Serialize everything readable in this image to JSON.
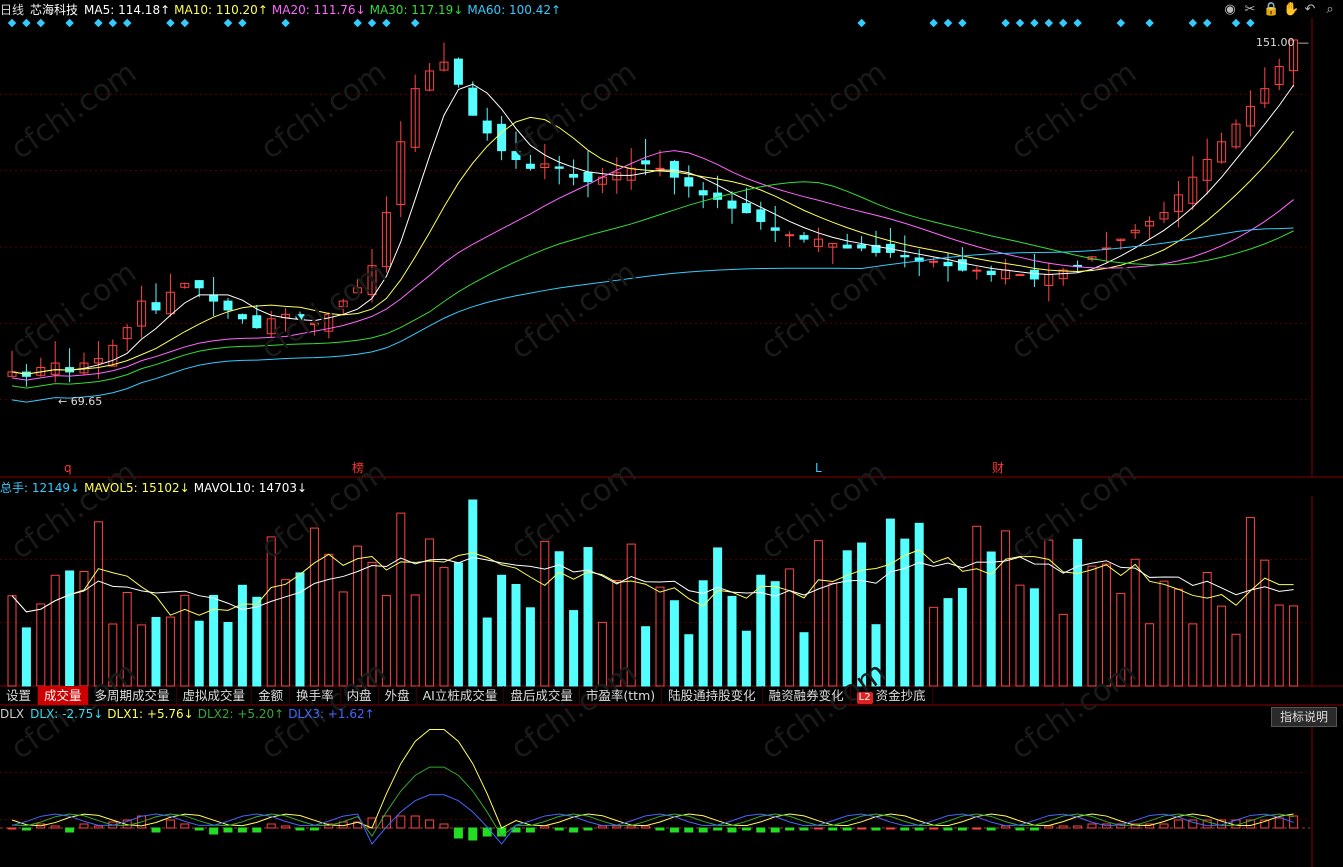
{
  "header": {
    "period": "日线",
    "stock_name": "芯海科技",
    "ma": [
      {
        "label": "MA5:",
        "value": "114.18",
        "arrow": "↑",
        "color": "#ffffff"
      },
      {
        "label": "MA10:",
        "value": "110.20",
        "arrow": "↑",
        "color": "#ffff55"
      },
      {
        "label": "MA20:",
        "value": "111.76",
        "arrow": "↓",
        "color": "#ff66ff"
      },
      {
        "label": "MA30:",
        "value": "117.19",
        "arrow": "↓",
        "color": "#33dd33"
      },
      {
        "label": "MA60:",
        "value": "100.42",
        "arrow": "↑",
        "color": "#33ccff"
      }
    ]
  },
  "toolbar": {
    "icons": [
      "eye-icon",
      "scissors-icon",
      "lock-icon",
      "hand-icon",
      "undo-icon",
      "search-icon"
    ],
    "glyphs": [
      "◉",
      "✂",
      "🔒",
      "✋",
      "↶",
      "⌕"
    ]
  },
  "price_panel": {
    "high_label": "151.00",
    "low_label": "69.65",
    "markers": [
      {
        "text": "q",
        "color": "#ff3333"
      },
      {
        "text": "榜",
        "color": "#ff3333"
      },
      {
        "text": "L",
        "color": "#33ccff"
      },
      {
        "text": "财",
        "color": "#ff3333"
      }
    ]
  },
  "volume_panel": {
    "items": [
      {
        "label": "总手:",
        "value": "12149",
        "arrow": "↓",
        "color": "#33ccff"
      },
      {
        "label": "MAVOL5:",
        "value": "15102",
        "arrow": "↓",
        "color": "#ffff55"
      },
      {
        "label": "MAVOL10:",
        "value": "14703",
        "arrow": "↓",
        "color": "#ffffff"
      }
    ]
  },
  "tabs": [
    "设置",
    "成交量",
    "多周期成交量",
    "虚拟成交量",
    "金额",
    "换手率",
    "内盘",
    "外盘",
    "AI立桩成交量",
    "盘后成交量",
    "市盈率(ttm)",
    "陆股通持股变化",
    "融资融券变化",
    "资金抄底"
  ],
  "active_tab": "成交量",
  "l2_badge": "L2",
  "indicator_panel": {
    "name": "DLX",
    "items": [
      {
        "label": "DLX:",
        "value": "-2.75",
        "arrow": "↓",
        "color": "#33ddee"
      },
      {
        "label": "DLX1:",
        "value": "+5.76",
        "arrow": "↓",
        "color": "#ffff55"
      },
      {
        "label": "DLX2:",
        "value": "+5.20",
        "arrow": "↑",
        "color": "#33aa33"
      },
      {
        "label": "DLX3:",
        "value": "+1.62",
        "arrow": "↑",
        "color": "#4466ff"
      }
    ],
    "help_button": "指标说明"
  },
  "watermark": "cfchi.com",
  "chart_data": {
    "type": "candlestick",
    "price_range": [
      69.65,
      151.0
    ],
    "closes": [
      76,
      75,
      77,
      78,
      76,
      78,
      79,
      82,
      86,
      92,
      90,
      94,
      96,
      95,
      92,
      90,
      88,
      86,
      88,
      89,
      88,
      87,
      89,
      92,
      95,
      100,
      112,
      128,
      140,
      144,
      146,
      141,
      134,
      130,
      126,
      124,
      122,
      123,
      122,
      120,
      119,
      120,
      121,
      122,
      123,
      122,
      120,
      118,
      116,
      115,
      113,
      112,
      110,
      108,
      107,
      106,
      106,
      105,
      104,
      104,
      103,
      103,
      102,
      101,
      101,
      100,
      99,
      99,
      98,
      99,
      98,
      97,
      98,
      99,
      100,
      102,
      104,
      106,
      108,
      110,
      112,
      116,
      120,
      124,
      128,
      132,
      136,
      140,
      145,
      151
    ],
    "up_color": "#ff4444",
    "down_color": "#55ffff"
  }
}
